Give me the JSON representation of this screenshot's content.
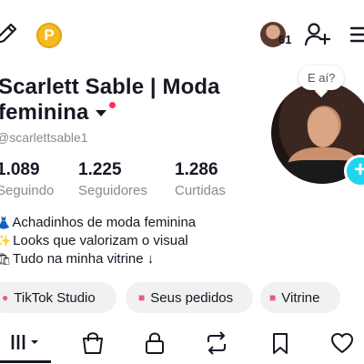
{
  "header": {
    "coin_label": "P",
    "friends_count": "61",
    "icons": [
      "edit-icon",
      "coin-icon",
      "friends-avatar",
      "add-user-icon",
      "menu-icon"
    ]
  },
  "profile": {
    "name": "Scarlett Sable | Moda feminina",
    "username": "@scarlettsable1",
    "bubble_text": "E aí?",
    "stats": [
      {
        "value": "1.089",
        "label": "Seguindo"
      },
      {
        "value": "1.225",
        "label": "Seguidores"
      },
      {
        "value": "1.286",
        "label": "Curtidas"
      }
    ],
    "bio": [
      {
        "emoji": "👗",
        "text": "Achadinhos de moda feminina"
      },
      {
        "emoji": "✨",
        "text": "Looks que valorizam o visual"
      },
      {
        "emoji": "🛍",
        "text": "Tudo na minha vitrine ↓"
      }
    ]
  },
  "actions": {
    "studio": "TikTok Studio",
    "orders": "Seus pedidos",
    "showcase": "Vitrine"
  },
  "tabs": [
    "videos-grid",
    "shop",
    "private",
    "reposts",
    "favorites",
    "liked"
  ],
  "colors": {
    "accent_cyan": "#20d5ec",
    "notification_red": "#fe2c55",
    "coin_gold": "#f5b921",
    "secondary_text": "#8a8b91",
    "button_bg": "#f1f1f2"
  }
}
